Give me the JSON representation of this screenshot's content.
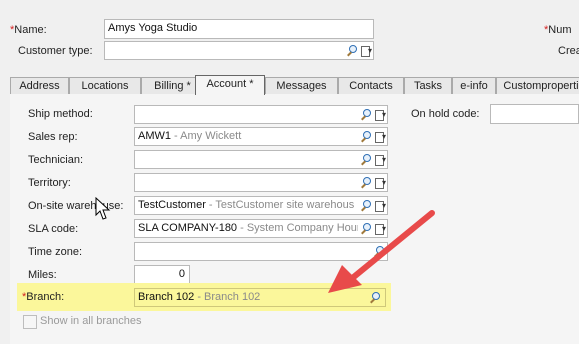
{
  "header": {
    "name_label": "Name:",
    "name_required": "*",
    "name_value": "Amys Yoga Studio",
    "customer_type_label": "Customer type:",
    "customer_type_value": "",
    "num_label_partial": "Num",
    "num_required": "*",
    "crea_label_partial": "Crea"
  },
  "tabs": [
    {
      "label": "Address"
    },
    {
      "label": "Locations"
    },
    {
      "label": "Billing *"
    },
    {
      "label": "Account *"
    },
    {
      "label": "Messages"
    },
    {
      "label": "Contacts"
    },
    {
      "label": "Tasks"
    },
    {
      "label": "e-info"
    },
    {
      "label": "Customproperti"
    }
  ],
  "account": {
    "ship_method": {
      "label": "Ship method:",
      "code": "",
      "desc": ""
    },
    "sales_rep": {
      "label": "Sales rep:",
      "code": "AMW1",
      "desc": " - Amy Wickett"
    },
    "technician": {
      "label": "Technician:",
      "code": "",
      "desc": ""
    },
    "territory": {
      "label": "Territory:",
      "code": "",
      "desc": ""
    },
    "onsite_warehouse": {
      "label": "On-site warehouse:",
      "code": "TestCustomer",
      "desc": " - TestCustomer site warehous"
    },
    "sla_code": {
      "label": "SLA code:",
      "code": "SLA COMPANY-180",
      "desc": " - System Company Hour"
    },
    "time_zone": {
      "label": "Time zone:",
      "code": "",
      "desc": ""
    },
    "miles": {
      "label": "Miles:",
      "value": "0"
    },
    "branch": {
      "label": "Branch:",
      "required": "*",
      "code": "Branch 102",
      "desc": " - Branch 102"
    },
    "show_all_branches": {
      "label": "Show in all branches",
      "checked": false
    },
    "on_hold_code": {
      "label": "On hold code:",
      "value": ""
    }
  },
  "colors": {
    "highlight": "#fbf79b",
    "arrow": "#e84a4a",
    "required": "#d42020"
  }
}
